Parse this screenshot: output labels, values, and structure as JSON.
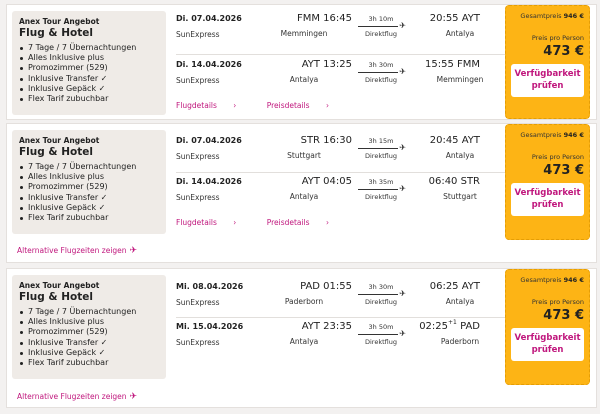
{
  "offers": [
    {
      "operator": "Anex Tour Angebot",
      "type": "Flug & Hotel",
      "features": [
        "7 Tage / 7 Übernachtungen",
        "Alles Inklusive plus",
        "Promozimmer (529)",
        "Inklusive Transfer ✓",
        "Inklusive Gepäck ✓",
        "Flex Tarif zubuchbar"
      ],
      "outbound": {
        "date": "Di. 07.04.2026",
        "airline": "SunExpress",
        "dep": "FMM 16:45",
        "dep_city": "Memmingen",
        "duration": "3h 10m",
        "stop": "Direktflug",
        "arr": "20:55 AYT",
        "arr_sup": "",
        "arr_city": "Antalya"
      },
      "return": {
        "date": "Di. 14.04.2026",
        "airline": "SunExpress",
        "dep": "AYT 13:25",
        "dep_city": "Antalya",
        "duration": "3h 30m",
        "stop": "Direktflug",
        "arr": "15:55 FMM",
        "arr_sup": "",
        "arr_city": "Memmingen"
      },
      "flight_details": "Flugdetails",
      "price_details": "Preisdetails",
      "total_label": "Gesamtpreis",
      "total": "946 €",
      "per_person_label": "Preis pro Person",
      "per_person": "473 €",
      "cta": "Verfügbarkeit prüfen"
    },
    {
      "operator": "Anex Tour Angebot",
      "type": "Flug & Hotel",
      "features": [
        "7 Tage / 7 Übernachtungen",
        "Alles Inklusive plus",
        "Promozimmer (529)",
        "Inklusive Transfer ✓",
        "Inklusive Gepäck ✓",
        "Flex Tarif zubuchbar"
      ],
      "outbound": {
        "date": "Di. 07.04.2026",
        "airline": "SunExpress",
        "dep": "STR 16:30",
        "dep_city": "Stuttgart",
        "duration": "3h 15m",
        "stop": "Direktflug",
        "arr": "20:45 AYT",
        "arr_sup": "",
        "arr_city": "Antalya"
      },
      "return": {
        "date": "Di. 14.04.2026",
        "airline": "SunExpress",
        "dep": "AYT 04:05",
        "dep_city": "Antalya",
        "duration": "3h 35m",
        "stop": "Direktflug",
        "arr": "06:40 STR",
        "arr_sup": "",
        "arr_city": "Stuttgart"
      },
      "flight_details": "Flugdetails",
      "price_details": "Preisdetails",
      "total_label": "Gesamtpreis",
      "total": "946 €",
      "per_person_label": "Preis pro Person",
      "per_person": "473 €",
      "cta": "Verfügbarkeit prüfen",
      "alt_times": "Alternative Flugzeiten zeigen"
    },
    {
      "operator": "Anex Tour Angebot",
      "type": "Flug & Hotel",
      "features": [
        "7 Tage / 7 Übernachtungen",
        "Alles Inklusive plus",
        "Promozimmer (529)",
        "Inklusive Transfer ✓",
        "Inklusive Gepäck ✓",
        "Flex Tarif zubuchbar"
      ],
      "outbound": {
        "date": "Mi. 08.04.2026",
        "airline": "SunExpress",
        "dep": "PAD 01:55",
        "dep_city": "Paderborn",
        "duration": "3h 30m",
        "stop": "Direktflug",
        "arr": "06:25 AYT",
        "arr_sup": "",
        "arr_city": "Antalya"
      },
      "return": {
        "date": "Mi. 15.04.2026",
        "airline": "SunExpress",
        "dep": "AYT 23:35",
        "dep_city": "Antalya",
        "duration": "3h 50m",
        "stop": "Direktflug",
        "arr_time": "02:25",
        "arr_sup": "+1",
        "arr_code": "PAD",
        "arr_city": "Paderborn"
      },
      "total_label": "Gesamtpreis",
      "total": "946 €",
      "per_person_label": "Preis pro Person",
      "per_person": "473 €",
      "cta": "Verfügbarkeit prüfen",
      "alt_times": "Alternative Flugzeiten zeigen"
    }
  ],
  "icons": {
    "plane": "plane-icon",
    "chevron": "chevron-right-icon"
  },
  "colors": {
    "accent": "#c0177d",
    "price_bg": "#fdb415",
    "card_bg": "#ffffff",
    "pkg_bg": "#efebe7"
  }
}
